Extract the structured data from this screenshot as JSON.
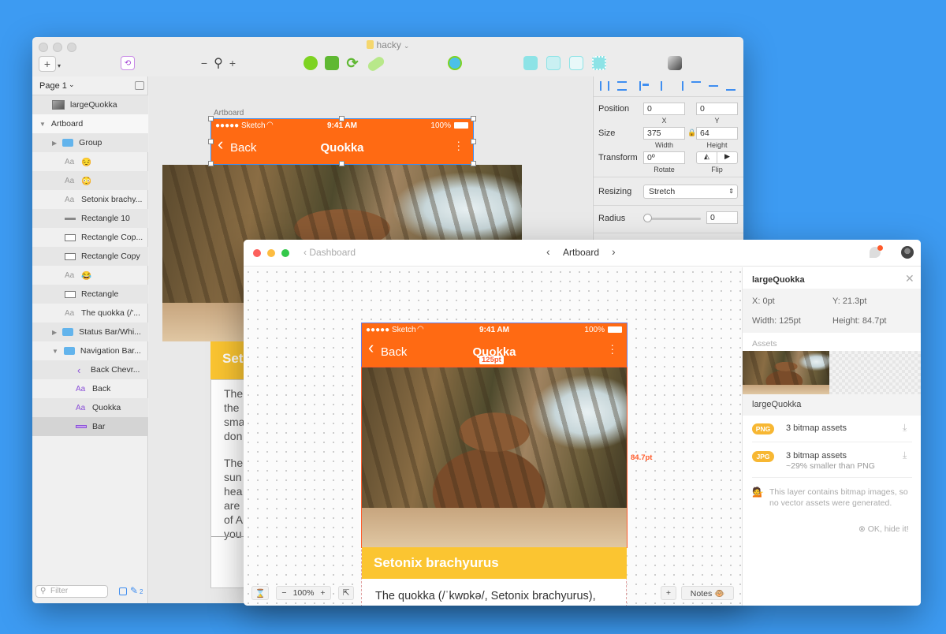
{
  "sketch": {
    "title": "hacky",
    "page": "Page 1",
    "filter_placeholder": "Filter",
    "edit_count": "2",
    "zoom_minus": "−",
    "zoom_plus": "+",
    "layers": [
      {
        "label": "largeQuokka",
        "kind": "image"
      },
      {
        "label": "Artboard",
        "kind": "artboard"
      },
      {
        "label": "Group",
        "kind": "folder"
      },
      {
        "label": "😔",
        "kind": "text"
      },
      {
        "label": "😳",
        "kind": "text"
      },
      {
        "label": "Setonix brachy...",
        "kind": "text"
      },
      {
        "label": "Rectangle 10",
        "kind": "line"
      },
      {
        "label": "Rectangle Cop...",
        "kind": "rect"
      },
      {
        "label": "Rectangle Copy",
        "kind": "rect"
      },
      {
        "label": "😂",
        "kind": "text"
      },
      {
        "label": "Rectangle",
        "kind": "rect"
      },
      {
        "label": "The quokka (/'...",
        "kind": "text"
      },
      {
        "label": "Status Bar/Whi...",
        "kind": "folder"
      },
      {
        "label": "Navigation Bar...",
        "kind": "folder"
      },
      {
        "label": "Back Chevr...",
        "kind": "chevron"
      },
      {
        "label": "Back",
        "kind": "text-purple"
      },
      {
        "label": "Quokka",
        "kind": "text-purple"
      },
      {
        "label": "Bar",
        "kind": "bar"
      }
    ],
    "text_icon_label": "Aa",
    "artboard_label": "Artboard",
    "phone": {
      "carrier": "●●●●● Sketch",
      "time": "9:41 AM",
      "battery": "100%",
      "back": "Back",
      "title": "Quokka",
      "banner": "Set",
      "paragraph1": [
        "The",
        "the",
        "sma",
        "don"
      ],
      "paragraph2": [
        "The",
        "sun",
        "hea",
        "are",
        "of A",
        "you"
      ]
    },
    "inspector": {
      "position_label": "Position",
      "pos_x": "0",
      "pos_y": "0",
      "x_label": "X",
      "y_label": "Y",
      "size_label": "Size",
      "width": "375",
      "height": "64",
      "width_label": "Width",
      "height_label": "Height",
      "transform_label": "Transform",
      "rotate": "0º",
      "rotate_label": "Rotate",
      "flip_label": "Flip",
      "resizing_label": "Resizing",
      "resizing_value": "Stretch",
      "radius_label": "Radius",
      "radius_value": "0"
    }
  },
  "preview": {
    "back_link": "Dashboard",
    "title": "Artboard",
    "phone": {
      "carrier": "●●●●● Sketch",
      "time": "9:41 AM",
      "battery": "100%",
      "back": "Back",
      "title": "Quokka",
      "banner": "Setonix brachyurus",
      "body": "The quokka (/ˈkwɒkə/, Setonix brachyurus),",
      "width_badge": "125pt",
      "height_badge": "84.7pt"
    },
    "zoom": "100%",
    "notes_label": "Notes 🐵",
    "sidebar": {
      "layer_name": "largeQuokka",
      "x": "X: 0pt",
      "y": "Y: 21.3pt",
      "width": "Width: 125pt",
      "height": "Height: 84.7pt",
      "assets_label": "Assets",
      "asset_name": "largeQuokka",
      "png_badge": "PNG",
      "png_text": "3 bitmap assets",
      "jpg_badge": "JPG",
      "jpg_text": "3 bitmap assets",
      "jpg_sub": "~29% smaller than PNG",
      "info_emoji": "💁",
      "info_text": "This layer contains bitmap images, so no vector assets were generated.",
      "hide_link": "OK, hide it!"
    }
  },
  "colors": {
    "desktop": "#3d9bf2",
    "nav_orange": "#ff6a13",
    "banner_yellow": "#fbc531",
    "selection_blue": "#3f8ef0",
    "measure_red": "#ff5a2a"
  }
}
